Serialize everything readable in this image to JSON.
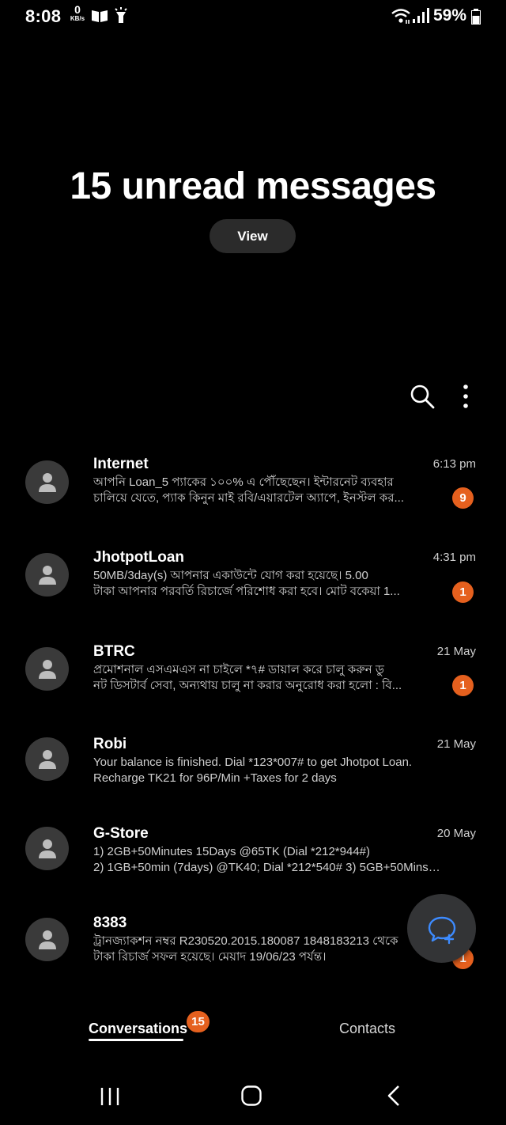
{
  "status_bar": {
    "time": "8:08",
    "net_speed_value": "0",
    "net_speed_unit": "KB/s",
    "battery_percent": "59%",
    "icons": [
      "book-icon",
      "torch-icon",
      "wifi-icon",
      "signal-icon",
      "battery-icon"
    ]
  },
  "banner": {
    "headline": "15 unread messages",
    "view_label": "View"
  },
  "toolbar": {
    "icons": [
      "search-icon",
      "more-options-icon"
    ]
  },
  "conversations": [
    {
      "name": "Internet",
      "time": "6:13 pm",
      "line1": "আপনি Loan_5 প্যাকের ১০০% এ পৌঁছেছেন। ইন্টারনেট ব্যবহার",
      "line2": "চালিয়ে যেতে, প্যাক কিনুন মাই রবি/এয়ারটেল অ্যাপে, ইনস্টল কর...",
      "unread": "9"
    },
    {
      "name": "JhotpotLoan",
      "time": "4:31 pm",
      "line1": "50MB/3day(s) আপনার একাউন্টে যোগ করা হয়েছে। 5.00",
      "line2": "টাকা আপনার পরবর্তি রিচার্জে পরিশোধ করা হবে। মোট বকেয়া 1...",
      "unread": "1"
    },
    {
      "name": "BTRC",
      "time": "21 May",
      "line1": "প্রমোশনাল এসএমএস না চাইলে *৭# ডায়াল করে চালু করুন ডু",
      "line2": "নট ডিসটার্ব সেবা, অন্যথায় চালু না করার অনুরোধ করা হলো : বি...",
      "unread": "1"
    },
    {
      "name": "Robi",
      "time": "21 May",
      "line1": "Your balance is finished. Dial *123*007# to get Jhotpot Loan.",
      "line2": "Recharge TK21 for 96P/Min +Taxes for 2 days",
      "unread": ""
    },
    {
      "name": "G-Store",
      "time": "20 May",
      "line1": "1) 2GB+50Minutes 15Days @65TK (Dial *212*944#)",
      "line2": "2) 1GB+50min (7days) @TK40; Dial *212*540# 3) 5GB+50Mins(3...",
      "unread": ""
    },
    {
      "name": "8383",
      "time": "",
      "line1": "ট্রানজ্যাকশন নম্বর R230520.2015.180087 1848183213 থেকে",
      "line2": "টাকা রিচার্জ সফল হয়েছে। মেয়াদ 19/06/23 পর্যন্ত।",
      "unread": "1"
    }
  ],
  "tabs": {
    "conversations_label": "Conversations",
    "conversations_badge": "15",
    "contacts_label": "Contacts"
  },
  "colors": {
    "background": "#000000",
    "badge": "#e5601e",
    "fab": "#333436",
    "fab_icon": "#3d8bff"
  }
}
